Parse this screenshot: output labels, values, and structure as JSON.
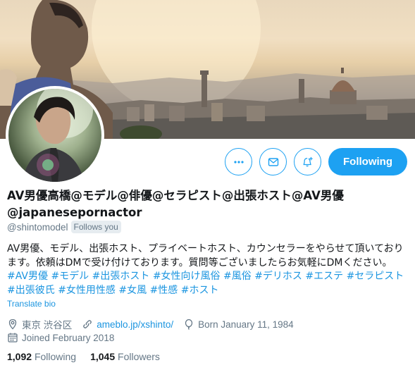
{
  "profile": {
    "display_name": "AV男優高橋@モデル@俳優@セラピスト@出張ホスト@AV男優@japanesepornactor",
    "handle": "@shintomodel",
    "follows_you": "Follows you",
    "bio_text": "AV男優、モデル、出張ホスト、プライベートホスト、カウンセラーをやらせて頂いております。依頼はDMで受け付けております。質問等ございましたらお気軽にDMください。",
    "hashtags": [
      "#AV男優",
      "#モデル",
      "#出張ホスト",
      "#女性向け風俗",
      "#風俗",
      "#デリホス",
      "#エステ",
      "#セラピスト",
      "#出張彼氏",
      "#女性用性感",
      "#女風",
      "#性感",
      "#ホスト"
    ],
    "translate_bio": "Translate bio",
    "location": "東京 渋谷区",
    "website": "ameblo.jp/xshinto/",
    "birthday": "Born January 11, 1984",
    "joined": "Joined February 2018"
  },
  "actions": {
    "more_icon": "more-icon",
    "message_icon": "mail-icon",
    "notify_icon": "bell-plus-icon",
    "follow_label": "Following"
  },
  "stats": {
    "following_count": "1,092",
    "following_label": "Following",
    "followers_count": "1,045",
    "followers_label": "Followers"
  },
  "colors": {
    "accent": "#1da1f2",
    "link": "#1b95e0",
    "muted": "#657786"
  }
}
